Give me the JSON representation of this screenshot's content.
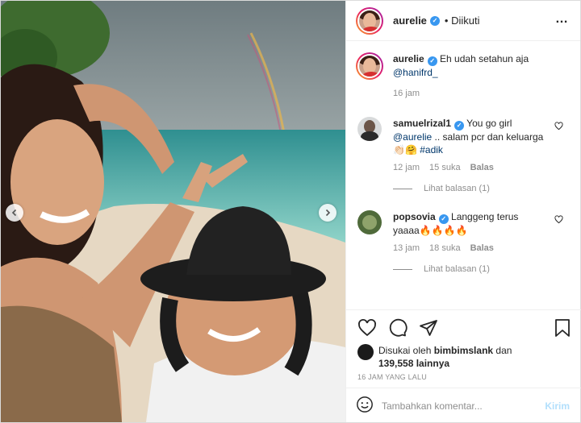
{
  "post": {
    "author": "aurelie",
    "follow_status": "• Diikuti",
    "more_icon": "…"
  },
  "photo": {
    "description_icons": [
      "chevron-left-icon",
      "chevron-right-icon"
    ]
  },
  "comments": [
    {
      "user": "aurelie",
      "verified": true,
      "text_plain": "Eh udah setahun aja",
      "mention": "@hanifrd_",
      "age": "16 jam"
    },
    {
      "user": "samuelrizal1",
      "verified": true,
      "text_plain": "You go girl",
      "mention": "@aurelie",
      "text_rest": " .. salam pcr dan keluarga 👏🏻🤗",
      "hashtag": "#adik",
      "age": "12 jam",
      "likes": "15 suka",
      "reply_label": "Balas",
      "view_replies": "Lihat balasan (1)"
    },
    {
      "user": "popsovia",
      "verified": true,
      "text_plain": "Langgeng terus yaaaa🔥🔥🔥🔥",
      "age": "13 jam",
      "likes": "18 suka",
      "reply_label": "Balas",
      "view_replies": "Lihat balasan (1)"
    }
  ],
  "likes": {
    "prefix": "Disukai oleh",
    "liker": "bimbimslank",
    "connector": "dan",
    "count": "139,558 lainnya"
  },
  "timestamp": "16 JAM YANG LALU",
  "composer": {
    "placeholder": "Tambahkan komentar...",
    "send_label": "Kirim"
  },
  "colors": {
    "link": "#00376b",
    "verified": "#3897f0",
    "muted": "#8e8e8e"
  }
}
